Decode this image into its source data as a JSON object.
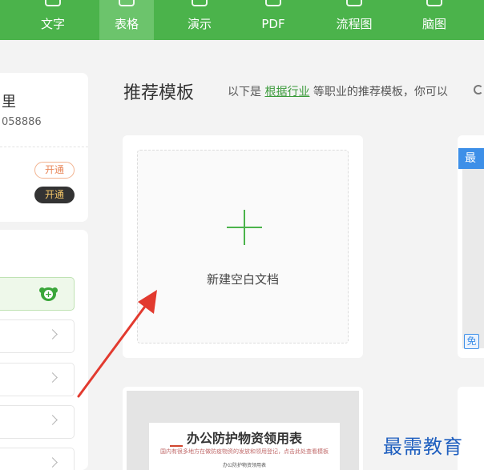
{
  "tabs": [
    {
      "label": "文字",
      "active": false
    },
    {
      "label": "表格",
      "active": true
    },
    {
      "label": "演示",
      "active": false
    },
    {
      "label": "PDF",
      "active": false
    },
    {
      "label": "流程图",
      "active": false
    },
    {
      "label": "脑图",
      "active": false
    }
  ],
  "user": {
    "name_fragment": "里",
    "id_fragment": "058886",
    "btn_open_outline": "开通",
    "btn_open_dark": "开通"
  },
  "header": {
    "title": "推荐模板",
    "sub_prefix": "以下是 ",
    "sub_link": "根据行业",
    "sub_suffix": " 等职业的推荐模板，你可以"
  },
  "blank_card": {
    "label": "新建空白文档"
  },
  "right_card": {
    "badge_fragment": "最",
    "free_badge": "免"
  },
  "doc_card": {
    "title": "办公防护物资领用表",
    "subtitle": "国内有很多地方在做防疫物资的发放和领用登记，点击此处查看模板",
    "small": "办公防护物资领用表"
  },
  "watermark": "最需教育",
  "colors": {
    "brand_green": "#4bb34b",
    "arrow_red": "#e23a2f",
    "badge_blue": "#3d8fe8"
  }
}
